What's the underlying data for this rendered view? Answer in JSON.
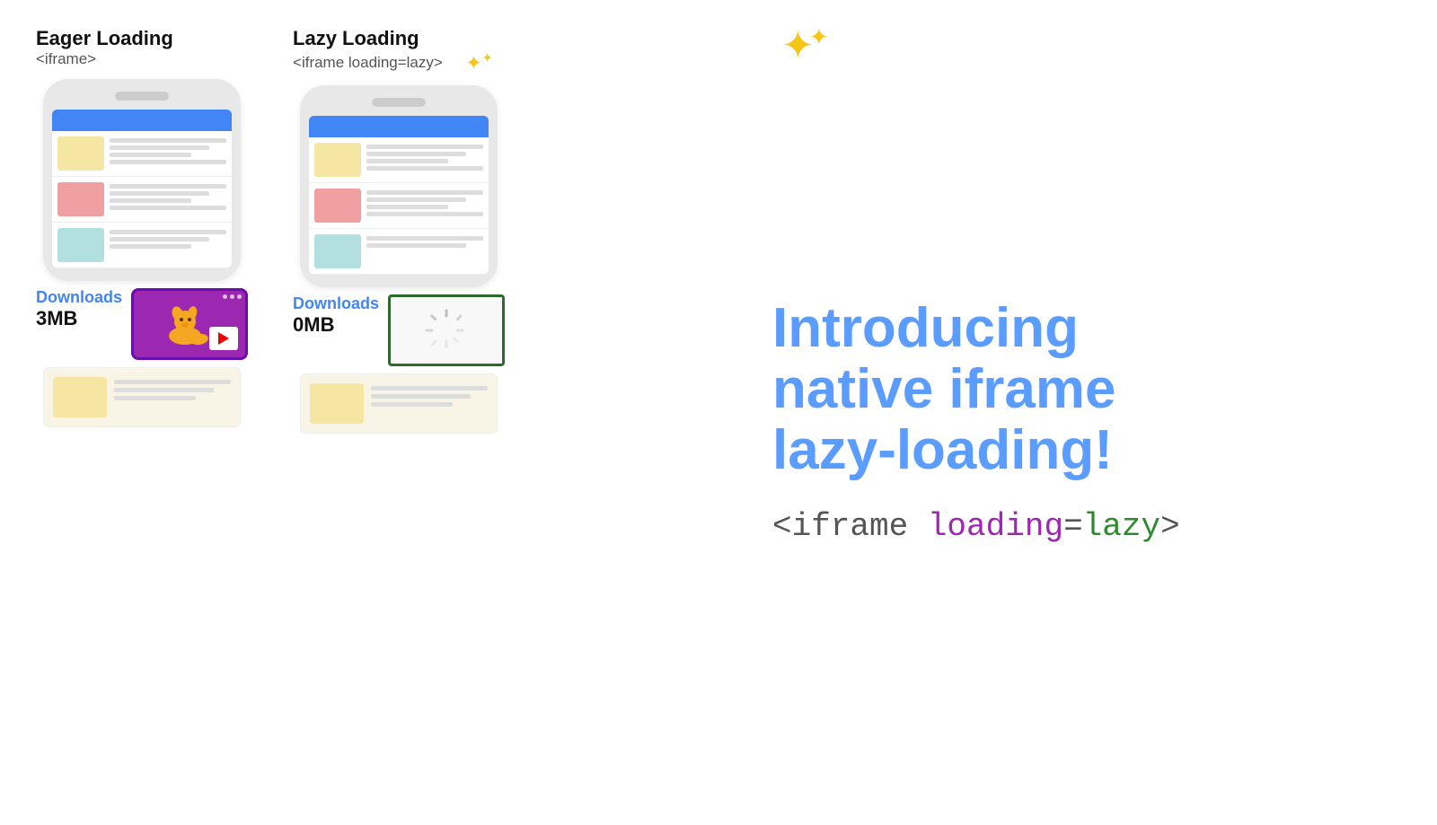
{
  "eager": {
    "title": "Eager Loading",
    "subtitle": "<iframe>",
    "downloads_label": "Downloads",
    "downloads_size": "3MB"
  },
  "lazy": {
    "title": "Lazy Loading",
    "subtitle": "<iframe loading=lazy>",
    "downloads_label": "Downloads",
    "downloads_size": "0MB"
  },
  "intro_heading": "Introducing\nnative iframe\nlazy-loading!",
  "code_snippet_parts": {
    "open": "<iframe ",
    "attr": "loading",
    "equals": "=",
    "value": "lazy",
    "close": ">"
  },
  "sparkle_label": "✦✦",
  "card_lines_count": 3
}
